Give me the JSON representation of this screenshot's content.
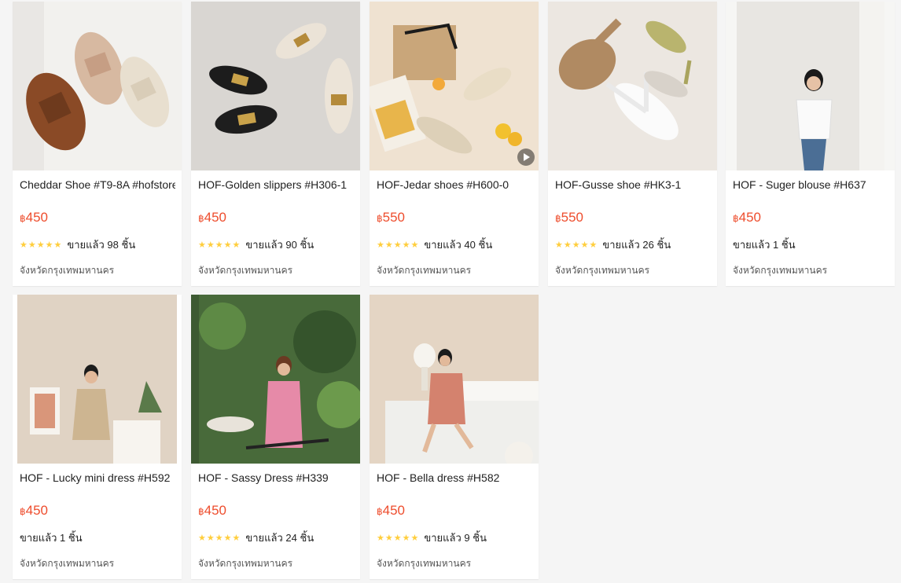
{
  "currency": "฿",
  "products": [
    {
      "title": "Cheddar Shoe #T9-8A #hofstore",
      "price": "450",
      "rating": 5,
      "sold": "ขายแล้ว 98 ชิ้น",
      "location": "จังหวัดกรุงเทพมหานคร"
    },
    {
      "title": "HOF-Golden slippers #H306-1",
      "price": "450",
      "rating": 5,
      "sold": "ขายแล้ว 90 ชิ้น",
      "location": "จังหวัดกรุงเทพมหานคร"
    },
    {
      "title": "HOF-Jedar shoes #H600-0",
      "price": "550",
      "rating": 5,
      "sold": "ขายแล้ว 40 ชิ้น",
      "location": "จังหวัดกรุงเทพมหานคร"
    },
    {
      "title": "HOF-Gusse shoe #HK3-1",
      "price": "550",
      "rating": 5,
      "sold": "ขายแล้ว 26 ชิ้น",
      "location": "จังหวัดกรุงเทพมหานคร"
    },
    {
      "title": "HOF - Suger blouse #H637",
      "price": "450",
      "rating": 0,
      "sold": "ขายแล้ว 1 ชิ้น",
      "location": "จังหวัดกรุงเทพมหานคร"
    },
    {
      "title": "HOF - Lucky mini dress #H592",
      "price": "450",
      "rating": 0,
      "sold": "ขายแล้ว 1 ชิ้น",
      "location": "จังหวัดกรุงเทพมหานคร"
    },
    {
      "title": "HOF - Sassy Dress #H339",
      "price": "450",
      "rating": 5,
      "sold": "ขายแล้ว 24 ชิ้น",
      "location": "จังหวัดกรุงเทพมหานคร"
    },
    {
      "title": "HOF - Bella dress #H582",
      "price": "450",
      "rating": 5,
      "sold": "ขายแล้ว 9 ชิ้น",
      "location": "จังหวัดกรุงเทพมหานคร"
    }
  ],
  "colors": {
    "price": "#ee4d2d",
    "star": "#ffce3d"
  },
  "icons": {
    "star": "star-icon",
    "play": "play-icon"
  }
}
